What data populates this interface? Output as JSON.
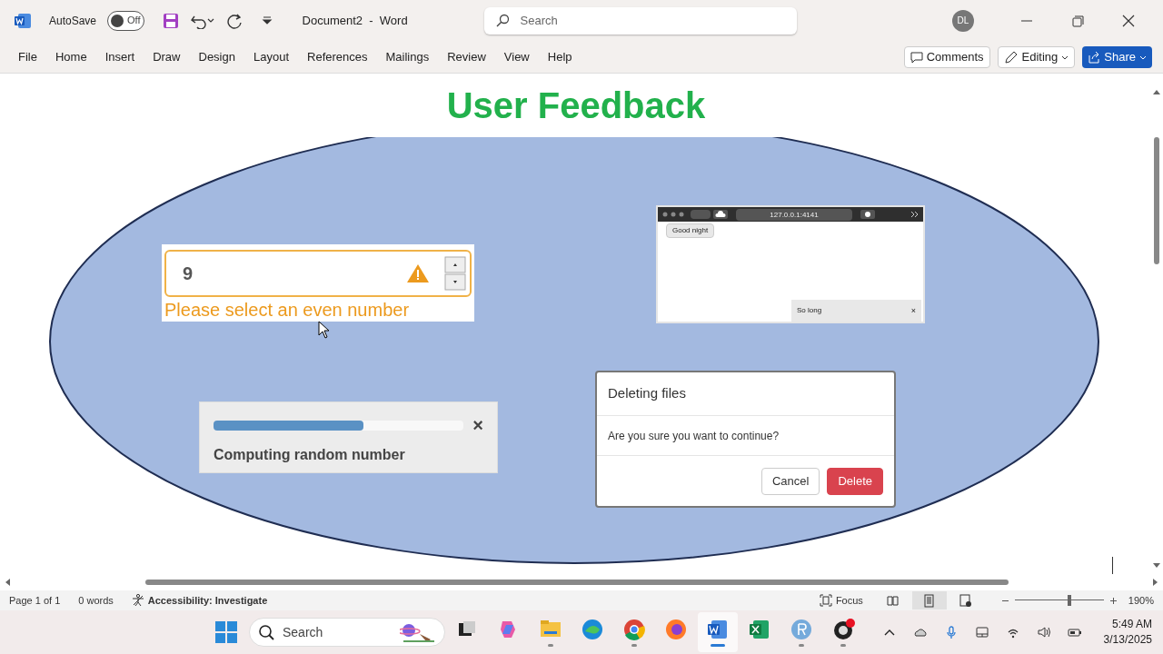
{
  "window": {
    "title": "Document2  -  Word",
    "autosave": {
      "label": "AutoSave",
      "on": false,
      "state": "Off"
    },
    "search": {
      "placeholder": "Search"
    },
    "user": "DL"
  },
  "ribbon": {
    "tabs": [
      "File",
      "Home",
      "Insert",
      "Draw",
      "Design",
      "Layout",
      "References",
      "Mailings",
      "Review",
      "View",
      "Help"
    ],
    "comments": "Comments",
    "editing": "Editing",
    "share": "Share"
  },
  "document": {
    "heading": "User Feedback",
    "validation": {
      "value": "9",
      "message": "Please select an even number"
    },
    "browser": {
      "url": "127.0.0.1:4141",
      "button": "Good night",
      "toast": "So long",
      "toast_close": "×"
    },
    "progress": {
      "level": 0.6,
      "label": "Computing random number",
      "close": "×"
    },
    "dialog": {
      "title": "Deleting files",
      "body": "Are you sure you want to continue?",
      "buttons": [
        {
          "label": "Cancel",
          "kind": "secondary"
        },
        {
          "label": "Delete",
          "kind": "danger"
        }
      ]
    }
  },
  "status_bar": {
    "page": "Page 1 of 1",
    "words": "0 words",
    "accessibility": "Accessibility: Investigate",
    "focus": "Focus",
    "views": [
      {
        "kind": "read",
        "selected": false
      },
      {
        "kind": "print",
        "selected": true
      },
      {
        "kind": "web",
        "selected": false
      }
    ],
    "zoom": {
      "level": 0.61,
      "reading": "190%"
    }
  },
  "taskbar": {
    "search": {
      "placeholder": "Search"
    },
    "apps": [
      {
        "kind": "files",
        "running": false
      },
      {
        "kind": "copilot",
        "running": false
      },
      {
        "kind": "folder",
        "running": true
      },
      {
        "kind": "edge",
        "running": false
      },
      {
        "kind": "chrome",
        "running": true
      },
      {
        "kind": "firefox",
        "running": false
      },
      {
        "kind": "word",
        "running": true
      },
      {
        "kind": "excel",
        "running": false
      },
      {
        "kind": "r",
        "running": true
      },
      {
        "kind": "obs",
        "running": true
      }
    ],
    "time": "5:49 AM",
    "date": "3/13/2025"
  }
}
